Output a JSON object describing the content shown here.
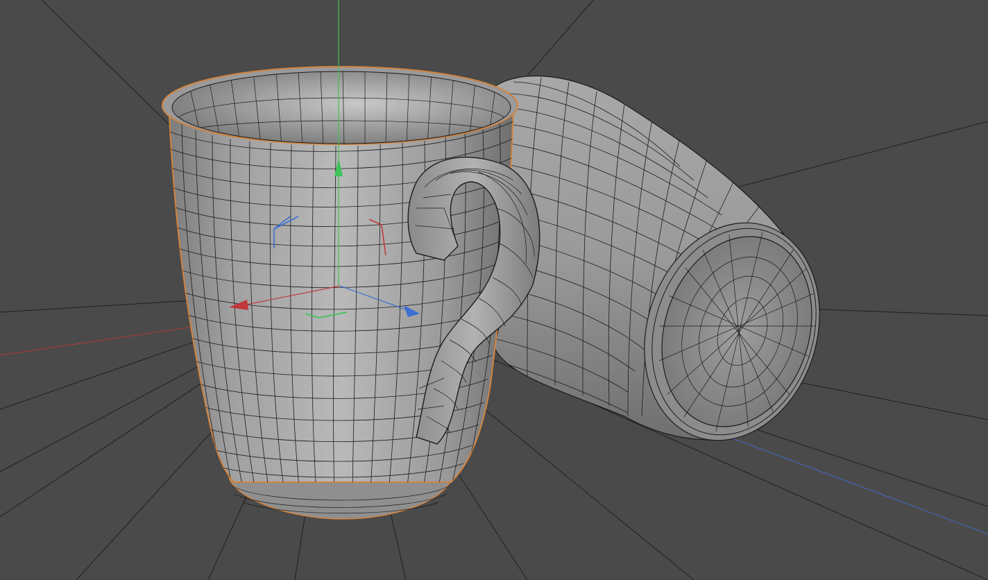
{
  "viewport": {
    "kind": "3d-perspective-viewport",
    "background_color": "#4a4a4a",
    "grid_line_color": "#1e1e1e",
    "axis_colors": {
      "x": "#c0383a",
      "y": "#3ec25a",
      "z": "#3b6fd1"
    },
    "selection_outline_color": "#d2843f"
  },
  "objects": [
    {
      "name": "mug-standing",
      "state": "selected",
      "display": "gouraud-shading-with-wireframe",
      "color": "#a9a9a9"
    },
    {
      "name": "mug-lying",
      "state": "unselected",
      "display": "gouraud-shading-with-wireframe",
      "color": "#9c9c9c"
    }
  ],
  "gizmo": {
    "type": "move-tool",
    "handles": [
      "x-axis-arrow",
      "y-axis-arrow",
      "z-axis-arrow",
      "xy-plane-handle",
      "yz-plane-handle",
      "xz-plane-handle"
    ]
  }
}
